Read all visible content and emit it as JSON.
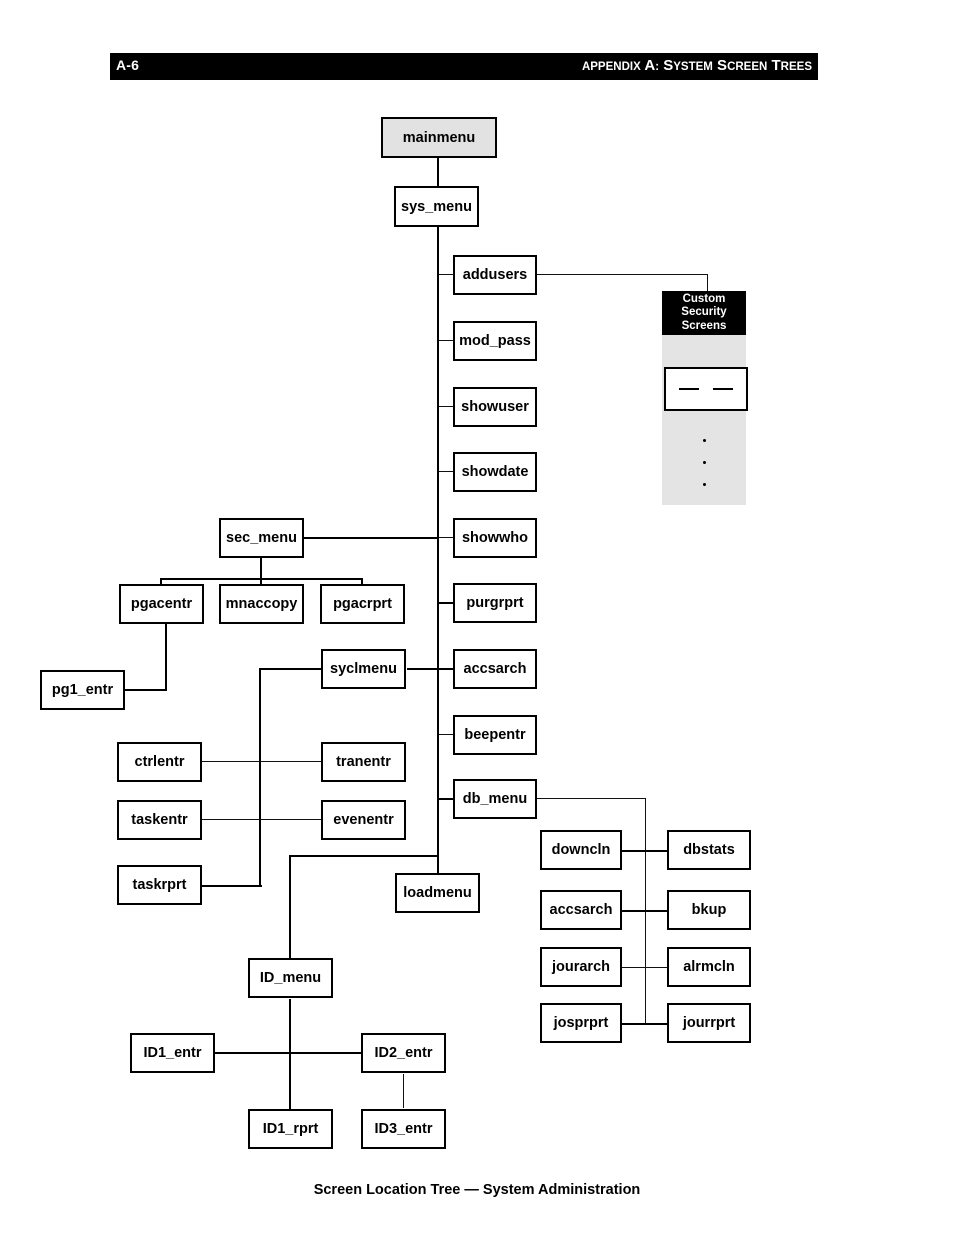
{
  "header": {
    "page_number": "A-6",
    "title_lead": "A",
    "title_parts": [
      "Appendix",
      "A:",
      "System",
      "Screen",
      "Trees"
    ],
    "title_full": "APPENDIX A: SYSTEM SCREEN TREES",
    "bar_color": "#000000",
    "text_color": "#ffffff"
  },
  "caption": {
    "text": "Screen Location Tree — System Administration"
  },
  "diagram": {
    "root_fill": "#e2e2e2",
    "node_fill": "#ffffff",
    "line_color": "#000000",
    "nodes": {
      "mainmenu": "mainmenu",
      "sys_menu": "sys_menu",
      "addusers": "addusers",
      "mod_pass": "mod_pass",
      "showuser": "showuser",
      "showdate": "showdate",
      "showwho": "showwho",
      "purgrprt": "purgrprt",
      "accsarch": "accsarch",
      "beepentr": "beepentr",
      "db_menu": "db_menu",
      "sec_menu": "sec_menu",
      "pgacentr": "pgacentr",
      "mnaccopy": "mnaccopy",
      "pgacrprt": "pgacrprt",
      "pg1_entr": "pg1_entr",
      "syclmenu": "syclmenu",
      "ctrlentr": "ctrlentr",
      "tranentr": "tranentr",
      "taskentr": "taskentr",
      "evenentr": "evenentr",
      "taskrprt": "taskrprt",
      "loadmenu": "loadmenu",
      "ID_menu": "ID_menu",
      "ID1_entr": "ID1_entr",
      "ID2_entr": "ID2_entr",
      "ID1_rprt": "ID1_rprt",
      "ID3_entr": "ID3_entr",
      "downcln": "downcln",
      "dbstats": "dbstats",
      "accsarch2": "accsarch",
      "bkup": "bkup",
      "jourarch": "jourarch",
      "alrmcln": "alrmcln",
      "josprprt": "josprprt",
      "jourrprt": "jourrprt"
    },
    "custom_panel": {
      "header_line1": "Custom",
      "header_line2": "Security",
      "header_line3": "Screens",
      "header_bg": "#000000",
      "header_fg": "#ffffff",
      "body_bg": "#e4e4e4",
      "placeholder_dashes": 2,
      "ellipsis_dots": 3
    }
  }
}
